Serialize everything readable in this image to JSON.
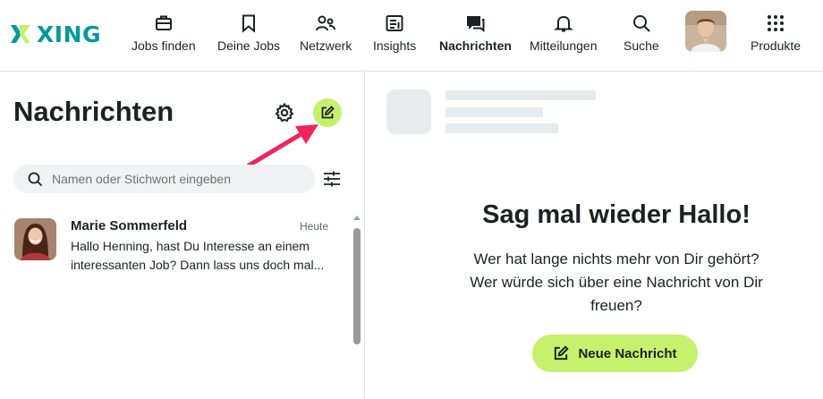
{
  "brand": {
    "name": "XING",
    "color": "#0698a0",
    "accent": "#c6f16d"
  },
  "nav": {
    "items": [
      {
        "label": "Jobs finden",
        "icon": "briefcase-icon"
      },
      {
        "label": "Deine Jobs",
        "icon": "bookmark-icon"
      },
      {
        "label": "Netzwerk",
        "icon": "people-icon"
      },
      {
        "label": "Insights",
        "icon": "insights-icon"
      },
      {
        "label": "Nachrichten",
        "icon": "chat-icon",
        "active": true
      },
      {
        "label": "Mitteilungen",
        "icon": "bell-icon"
      },
      {
        "label": "Suche",
        "icon": "search-icon"
      },
      {
        "label": "Produkte",
        "icon": "grid-icon"
      }
    ]
  },
  "messages": {
    "title": "Nachrichten",
    "search_placeholder": "Namen oder Stichwort eingeben",
    "conversations": [
      {
        "name": "Marie Sommerfeld",
        "time": "Heute",
        "preview": "Hallo Henning, hast Du Interesse an einem interessanten Job? Dann lass uns doch mal..."
      }
    ]
  },
  "empty_state": {
    "title": "Sag mal wieder Hallo!",
    "text": "Wer hat lange nichts mehr von Dir gehört? Wer würde sich über eine Nachricht von Dir freuen?",
    "button_label": "Neue Nachricht"
  }
}
